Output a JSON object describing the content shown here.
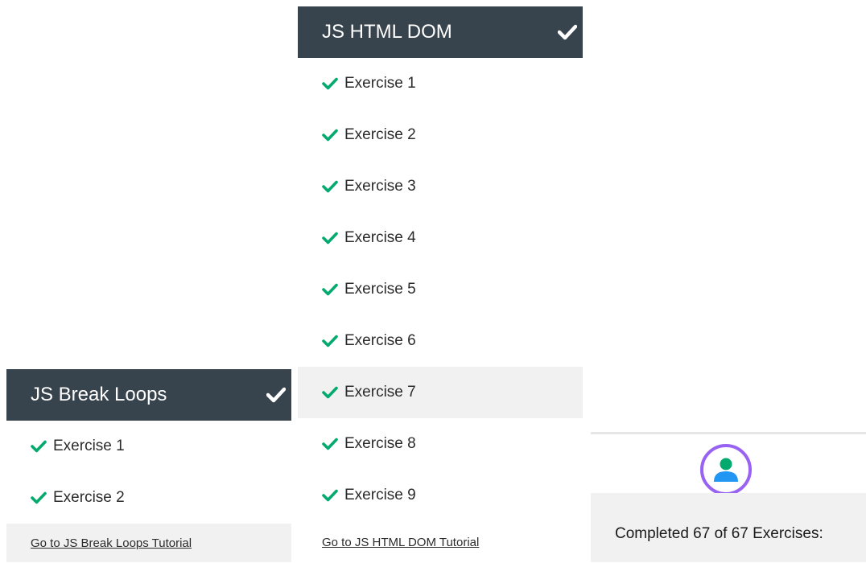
{
  "colors": {
    "header_bg": "#38444d",
    "check_green": "#04aa6d",
    "highlight_bg": "#f1f1f1",
    "avatar_ring": "#9863f2",
    "avatar_head": "#04aa6d",
    "avatar_body": "#2196f3"
  },
  "dom_panel": {
    "title": "JS HTML DOM",
    "header_icon": "check-icon",
    "items": [
      {
        "label": "Exercise 1",
        "icon": "check-icon"
      },
      {
        "label": "Exercise 2",
        "icon": "check-icon"
      },
      {
        "label": "Exercise 3",
        "icon": "check-icon"
      },
      {
        "label": "Exercise 4",
        "icon": "check-icon"
      },
      {
        "label": "Exercise 5",
        "icon": "check-icon"
      },
      {
        "label": "Exercise 6",
        "icon": "check-icon"
      },
      {
        "label": "Exercise 7",
        "icon": "check-icon",
        "highlighted": true
      },
      {
        "label": "Exercise 8",
        "icon": "check-icon"
      },
      {
        "label": "Exercise 9",
        "icon": "check-icon"
      }
    ],
    "tutorial_link": "Go to JS HTML DOM Tutorial"
  },
  "loops_panel": {
    "title": "JS Break Loops",
    "header_icon": "check-icon",
    "items": [
      {
        "label": "Exercise 1",
        "icon": "check-icon"
      },
      {
        "label": "Exercise 2",
        "icon": "check-icon"
      }
    ],
    "tutorial_link": "Go to JS Break Loops Tutorial"
  },
  "progress": {
    "avatar_icon": "user-avatar-icon",
    "text": "Completed 67 of 67 Exercises:"
  }
}
